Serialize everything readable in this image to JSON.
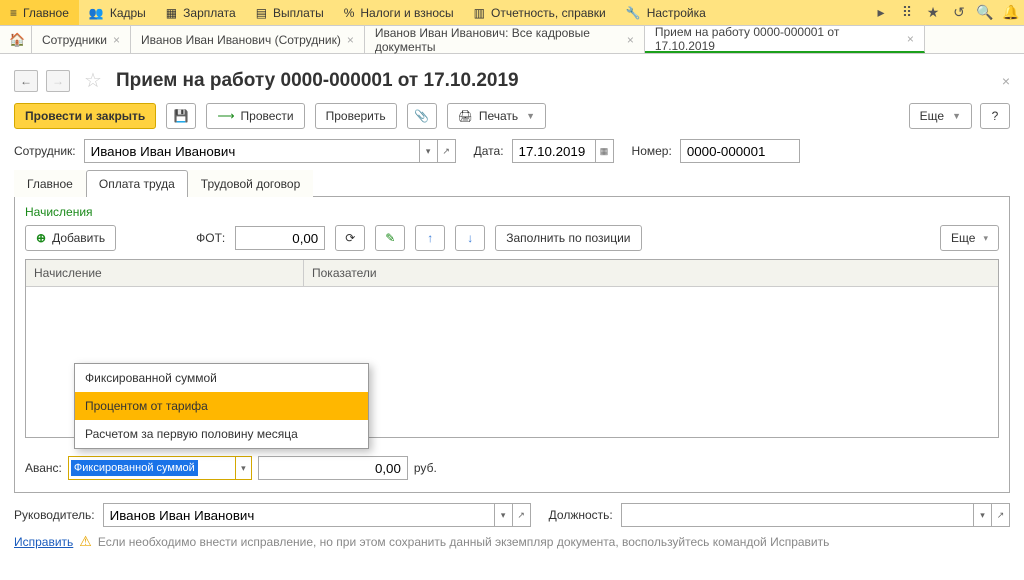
{
  "menu": [
    "Главное",
    "Кадры",
    "Зарплата",
    "Выплаты",
    "Налоги и взносы",
    "Отчетность, справки",
    "Настройка"
  ],
  "tabs": {
    "items": [
      "Сотрудники",
      "Иванов Иван Иванович (Сотрудник)",
      "Иванов Иван Иванович: Все кадровые документы",
      "Прием на работу 0000-000001 от 17.10.2019"
    ],
    "active": 3
  },
  "page_title": "Прием на работу 0000-000001 от 17.10.2019",
  "toolbar": {
    "post_close": "Провести и закрыть",
    "post": "Провести",
    "check": "Проверить",
    "print": "Печать",
    "more": "Еще"
  },
  "form": {
    "employee_lbl": "Сотрудник:",
    "employee": "Иванов Иван Иванович",
    "date_lbl": "Дата:",
    "date": "17.10.2019",
    "number_lbl": "Номер:",
    "number": "0000-000001"
  },
  "inner_tabs": [
    "Главное",
    "Оплата труда",
    "Трудовой договор"
  ],
  "inner_active": 1,
  "section": {
    "heading": "Начисления",
    "add": "Добавить",
    "fot_lbl": "ФОТ:",
    "fot_val": "0,00",
    "fill": "Заполнить по позиции",
    "more": "Еще",
    "cols": [
      "Начисление",
      "Показатели"
    ]
  },
  "dropdown": {
    "items": [
      "Фиксированной суммой",
      "Процентом от тарифа",
      "Расчетом за первую половину месяца"
    ],
    "selected": 1
  },
  "avans": {
    "lbl": "Аванс:",
    "value": "Фиксированной суммой",
    "amount": "0,00",
    "unit": "руб."
  },
  "bottom": {
    "head_lbl": "Руководитель:",
    "head": "Иванов Иван Иванович",
    "pos_lbl": "Должность:",
    "fix_link": "Исправить",
    "warning": "Если необходимо внести исправление, но при этом сохранить данный экземпляр документа, воспользуйтесь командой Исправить"
  }
}
